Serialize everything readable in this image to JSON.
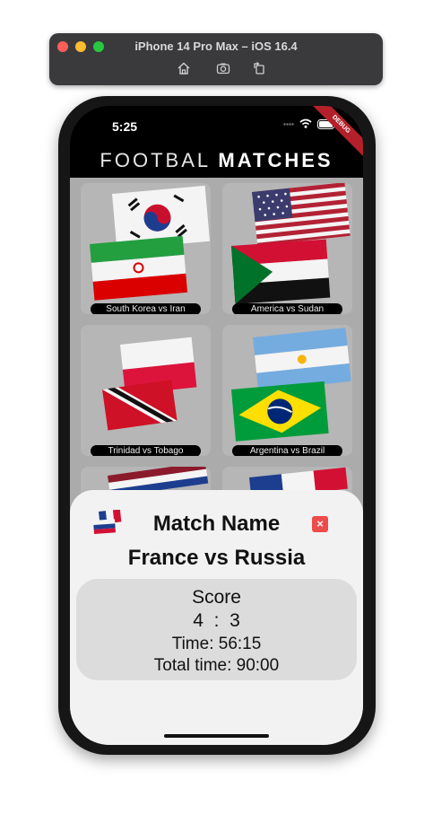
{
  "simulator": {
    "title": "iPhone 14 Pro Max – iOS 16.4",
    "tools": [
      "home-icon",
      "screenshot-icon",
      "rotate-icon"
    ]
  },
  "status_bar": {
    "time": "5:25",
    "debug_label": "DEBUG"
  },
  "app": {
    "title_light": "FOOTBAL",
    "title_bold": "MATCHES"
  },
  "matches": [
    {
      "label": "South Korea vs Iran",
      "flags": [
        "south-korea",
        "iran"
      ]
    },
    {
      "label": "America vs Sudan",
      "flags": [
        "usa",
        "sudan"
      ]
    },
    {
      "label": "Trinidad vs Tobago",
      "flags": [
        "poland",
        "trinidad-and-tobago"
      ]
    },
    {
      "label": "Argentina vs Brazil",
      "flags": [
        "argentina",
        "brazil"
      ]
    }
  ],
  "detail_sheet": {
    "heading": "Match Name",
    "match": "France vs Russia",
    "score_label": "Score",
    "score": "4  :  3",
    "time": "Time: 56:15",
    "total_time": "Total time: 90:00",
    "close_symbol": "×"
  },
  "colors": {
    "close_button": "#ee4b4b",
    "debug_banner": "#b3202a",
    "grid_background": "#ababab"
  }
}
